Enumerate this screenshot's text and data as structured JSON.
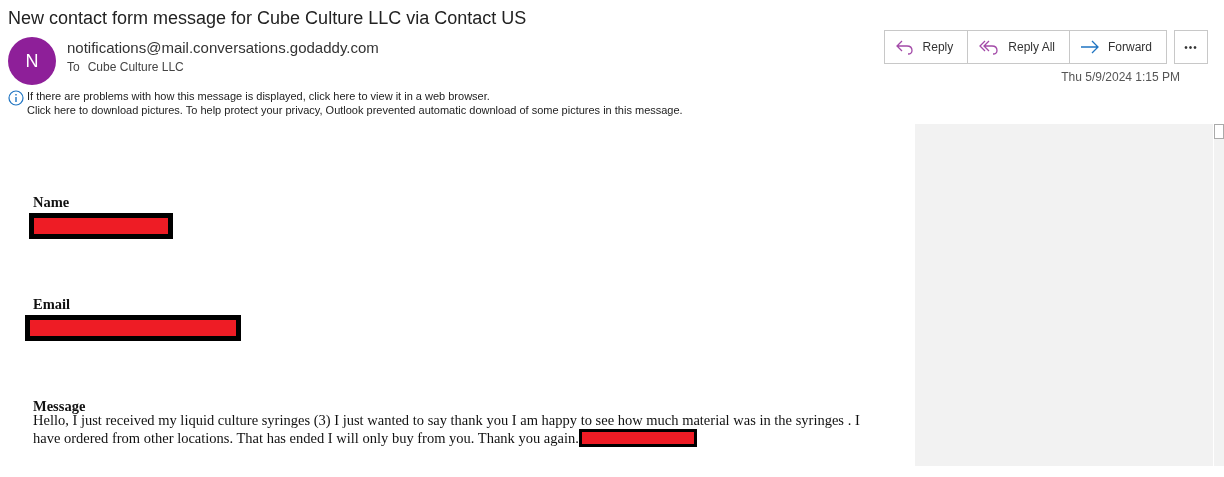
{
  "window": {
    "title": "New contact form message for Cube Culture LLC via Contact US"
  },
  "sender": {
    "avatar_initial": "N",
    "address": "notifications@mail.conversations.godaddy.com",
    "to_label": "To",
    "to": "Cube Culture LLC",
    "date": "Thu 5/9/2024 1:15 PM"
  },
  "actions": [
    {
      "kind": "reply",
      "label": "Reply"
    },
    {
      "kind": "reply_all",
      "label": "Reply All"
    },
    {
      "kind": "forward",
      "label": "Forward"
    },
    {
      "kind": "more",
      "label": "•••"
    }
  ],
  "info_bar": [
    "If there are problems with how this message is displayed, click here to view it in a web browser.",
    "Click here to download pictures. To help protect your privacy, Outlook prevented automatic download of some pictures in this message."
  ],
  "fields": [
    {
      "label": "Name",
      "redacted": true
    },
    {
      "label": "Email",
      "redacted": true
    }
  ],
  "message": {
    "label": "Message",
    "text": "Hello, I just received my liquid culture syringes (3) I just wanted to say thank you I am happy to see how much material was in the syringes . I have ordered from other locations. That has ended I will only buy from you. Thank you again.",
    "redacted": true
  }
}
